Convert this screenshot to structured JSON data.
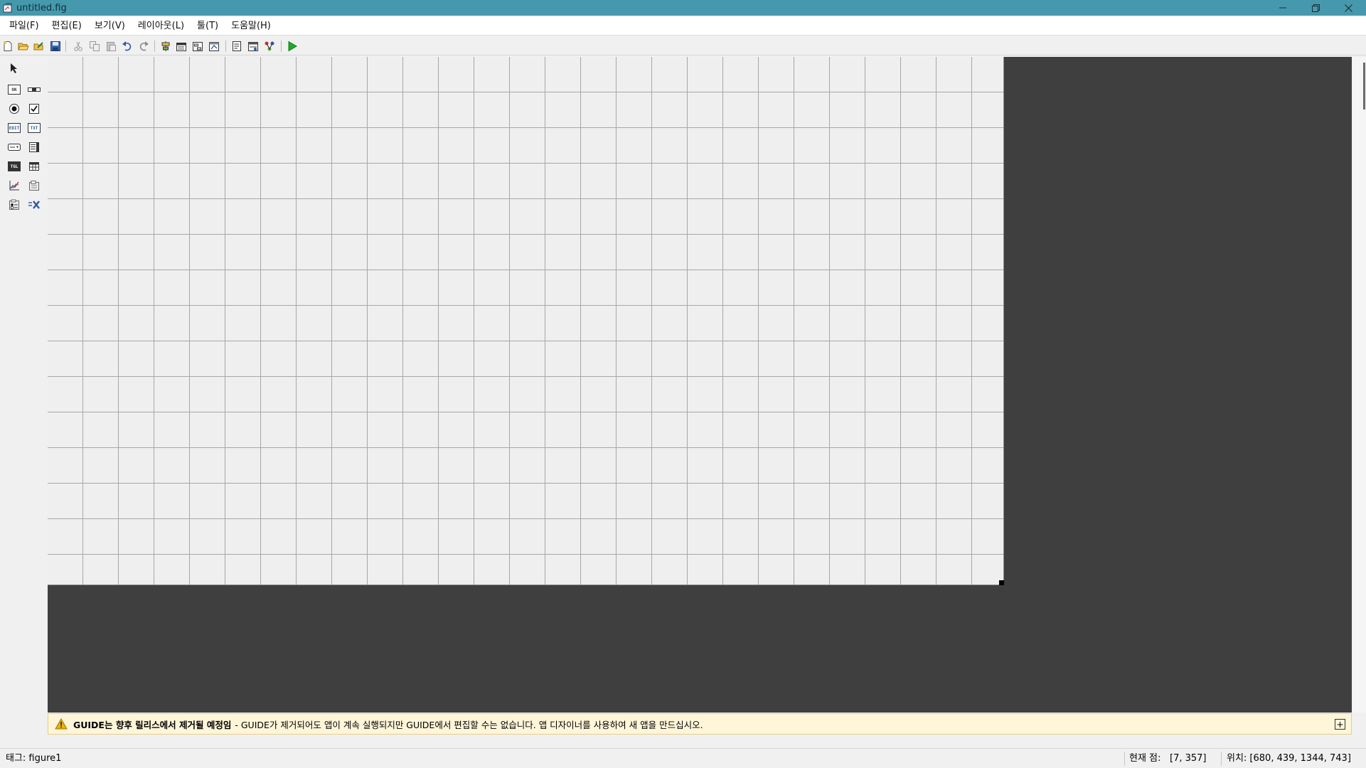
{
  "window": {
    "title": "untitled.fig"
  },
  "menu": [
    {
      "label": "파일(F)"
    },
    {
      "label": "편집(E)"
    },
    {
      "label": "보기(V)"
    },
    {
      "label": "레이아웃(L)"
    },
    {
      "label": "툴(T)"
    },
    {
      "label": "도움말(H)"
    }
  ],
  "toolbar": {
    "icons": [
      "new-file-icon",
      "open-icon",
      "open-fig-icon",
      "save-icon",
      "cut-icon",
      "copy-icon",
      "paste-icon",
      "undo-icon",
      "redo-icon",
      "align-objects-icon",
      "menu-editor-icon",
      "tab-order-editor-icon",
      "toolbar-editor-icon",
      "editor-icon",
      "property-inspector-icon",
      "object-browser-icon",
      "run-figure-icon"
    ]
  },
  "palette": {
    "icons": [
      "select-arrow-icon",
      "push-button-icon",
      "slider-icon",
      "radio-button-icon",
      "checkbox-icon",
      "edit-text-icon",
      "static-text-icon",
      "popup-menu-icon",
      "listbox-icon",
      "toggle-button-icon",
      "table-icon",
      "axes-icon",
      "panel-icon",
      "button-group-icon",
      "activex-control-icon"
    ],
    "glyphs": {
      "push": "OK",
      "edit": "EDIT",
      "static": "TXT",
      "toggle": "TGL"
    }
  },
  "banner": {
    "bold": "GUIDE는 향후 릴리스에서 제거될 예정임",
    "text": "- GUIDE가 제거되어도 앱이 계속 실행되지만 GUIDE에서 편집할 수는 없습니다. 앱 디자이너를 사용하여 새 앱을 만드십시오.",
    "expand_glyph": "+"
  },
  "status": {
    "tag": "태그: figure1",
    "current_point_label": "현재 점:",
    "current_point_value": "[7, 357]",
    "position": "위치: [680, 439, 1344, 743]"
  },
  "colors": {
    "titlebar": "#4699ad",
    "layout_background": "#3f3f3f",
    "canvas": "#efefef",
    "banner": "#fff5d9",
    "run_button": "#1faa2a"
  }
}
